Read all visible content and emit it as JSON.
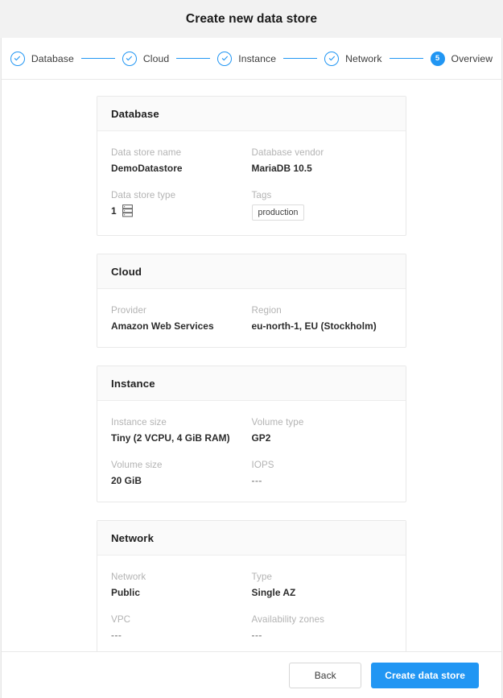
{
  "window": {
    "title": "Create new data store"
  },
  "stepper": {
    "steps": [
      {
        "label": "Database",
        "state": "done",
        "marker": "check"
      },
      {
        "label": "Cloud",
        "state": "done",
        "marker": "check"
      },
      {
        "label": "Instance",
        "state": "done",
        "marker": "check"
      },
      {
        "label": "Network",
        "state": "done",
        "marker": "check"
      },
      {
        "label": "Overview",
        "state": "active",
        "marker": "5"
      }
    ],
    "accent_color": "#2196f3"
  },
  "cards": [
    {
      "title": "Database",
      "rows": [
        [
          {
            "label": "Data store name",
            "value": "DemoDatastore",
            "kind": "text"
          },
          {
            "label": "Database vendor",
            "value": "MariaDB 10.5",
            "kind": "text"
          }
        ],
        [
          {
            "label": "Data store type",
            "value": "1",
            "kind": "count-icon",
            "icon": "server-rack-icon"
          },
          {
            "label": "Tags",
            "value": "production",
            "kind": "tag"
          }
        ]
      ]
    },
    {
      "title": "Cloud",
      "rows": [
        [
          {
            "label": "Provider",
            "value": "Amazon Web Services",
            "kind": "text"
          },
          {
            "label": "Region",
            "value": "eu-north-1, EU (Stockholm)",
            "kind": "text"
          }
        ]
      ]
    },
    {
      "title": "Instance",
      "rows": [
        [
          {
            "label": "Instance size",
            "value": "Tiny (2 VCPU, 4 GiB RAM)",
            "kind": "text"
          },
          {
            "label": "Volume type",
            "value": "GP2",
            "kind": "text"
          }
        ],
        [
          {
            "label": "Volume size",
            "value": "20 GiB",
            "kind": "text"
          },
          {
            "label": "IOPS",
            "value": "---",
            "kind": "empty"
          }
        ]
      ]
    },
    {
      "title": "Network",
      "rows": [
        [
          {
            "label": "Network",
            "value": "Public",
            "kind": "text"
          },
          {
            "label": "Type",
            "value": "Single AZ",
            "kind": "text"
          }
        ],
        [
          {
            "label": "VPC",
            "value": "---",
            "kind": "empty"
          },
          {
            "label": "Availability zones",
            "value": "---",
            "kind": "empty"
          }
        ]
      ]
    }
  ],
  "footer": {
    "back_label": "Back",
    "submit_label": "Create data store",
    "primary_color": "#2196f3"
  }
}
